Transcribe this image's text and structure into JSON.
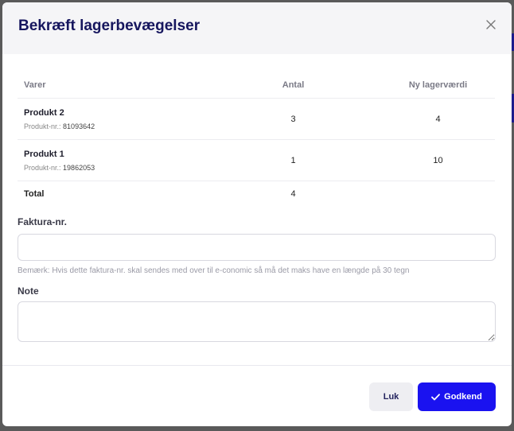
{
  "modal": {
    "title": "Bekræft lagerbevægelser",
    "close_icon": "close-icon"
  },
  "table": {
    "headers": {
      "item": "Varer",
      "qty": "Antal",
      "stock": "Ny lagerværdi"
    },
    "rows": [
      {
        "name": "Produkt 2",
        "num_label": "Produkt-nr.:",
        "num": "81093642",
        "qty": "3",
        "stock": "4"
      },
      {
        "name": "Produkt 1",
        "num_label": "Produkt-nr.:",
        "num": "19862053",
        "qty": "1",
        "stock": "10"
      }
    ],
    "total": {
      "label": "Total",
      "qty": "4"
    }
  },
  "invoice": {
    "label": "Faktura-nr.",
    "value": "",
    "hint": "Bemærk: Hvis dette faktura-nr. skal sendes med over til e-conomic så må det maks have en længde på 30 tegn"
  },
  "note": {
    "label": "Note",
    "value": ""
  },
  "footer": {
    "close_label": "Luk",
    "approve_label": "Godkend",
    "approve_icon": "check-icon"
  },
  "colors": {
    "primary": "#1a12f0",
    "title": "#16165e",
    "backdrop_accent": "#1c1c8c"
  }
}
